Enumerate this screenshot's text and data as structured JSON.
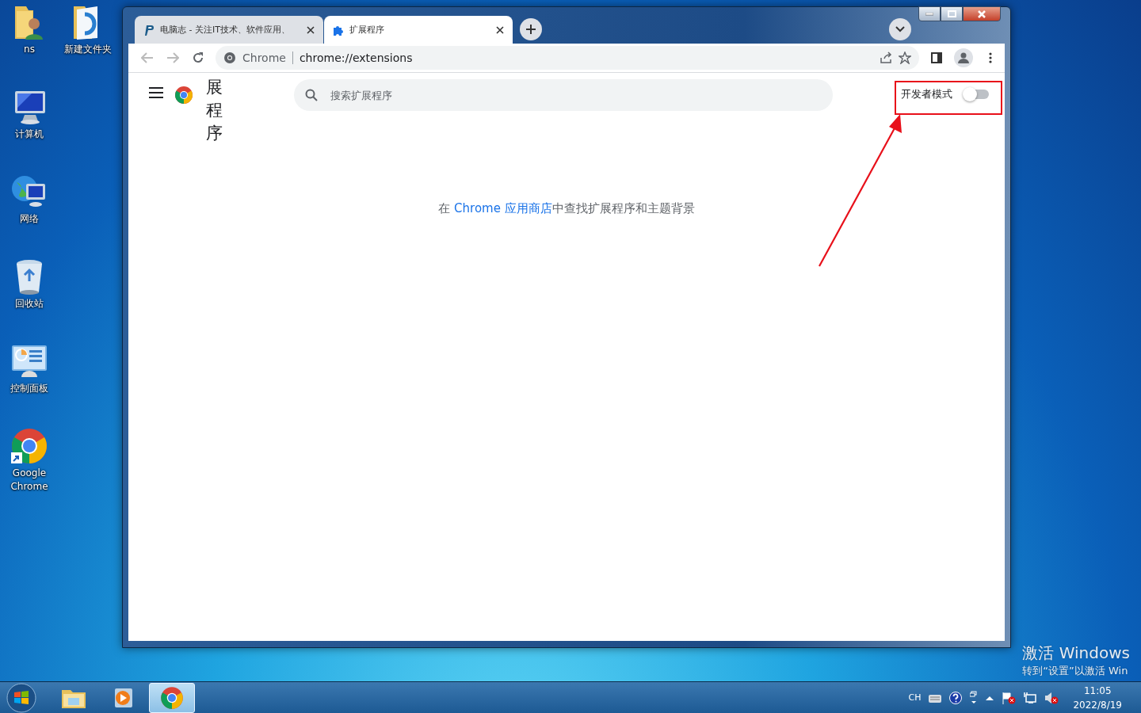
{
  "desktop": {
    "icons": [
      {
        "label": "ns",
        "kind": "user-folder"
      },
      {
        "label": "新建文件夹",
        "kind": "folder"
      },
      {
        "label": "计算机",
        "kind": "computer"
      },
      {
        "label": "网络",
        "kind": "network"
      },
      {
        "label": "回收站",
        "kind": "recycle"
      },
      {
        "label": "控制面板",
        "kind": "control-panel"
      },
      {
        "label": "Google Chrome",
        "kind": "chrome"
      }
    ],
    "activation_notice": {
      "title": "激活 Windows",
      "hint": "转到“设置”以激活 Win"
    }
  },
  "window": {
    "tabs": [
      {
        "title": "电脑志 - 关注IT技术、软件应用、",
        "kind": "site",
        "selected": false
      },
      {
        "title": "扩展程序",
        "kind": "extensions",
        "selected": true
      }
    ],
    "address": {
      "site": "Chrome",
      "url": "chrome://extensions"
    },
    "page": {
      "title": "展程序",
      "search_placeholder": "搜索扩展程序",
      "developer_mode": {
        "label": "开发者模式",
        "on": false
      },
      "store_text": {
        "before": "在 ",
        "link": "Chrome 应用商店",
        "after": "中查找扩展程序和主题背景"
      }
    }
  },
  "taskbar": {
    "items": [
      {
        "kind": "explorer",
        "selected": false
      },
      {
        "kind": "media",
        "selected": false
      },
      {
        "kind": "chrome",
        "selected": true
      }
    ],
    "tray": {
      "language": "CH",
      "time": "11:05",
      "date": "2022/8/19"
    }
  }
}
